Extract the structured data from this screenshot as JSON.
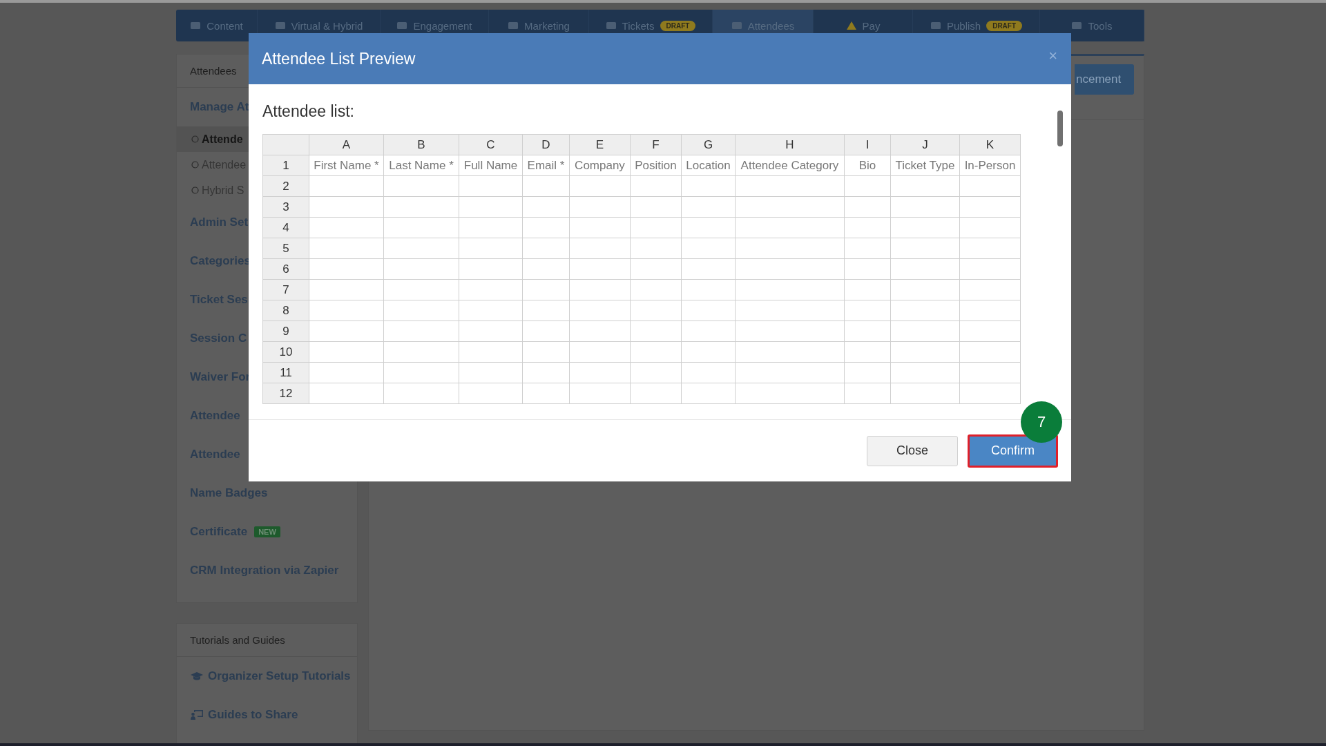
{
  "nav": {
    "tabs": [
      {
        "label": "Content",
        "selected": false
      },
      {
        "label": "Virtual & Hybrid",
        "selected": false
      },
      {
        "label": "Engagement",
        "selected": false
      },
      {
        "label": "Marketing",
        "selected": false
      },
      {
        "label": "Tickets",
        "badge": "DRAFT",
        "selected": false
      },
      {
        "label": "Attendees",
        "selected": true
      },
      {
        "label": "Pay",
        "selected": false
      },
      {
        "label": "Publish",
        "badge": "DRAFT",
        "selected": false
      },
      {
        "label": "Tools",
        "selected": false
      }
    ]
  },
  "sidebar": {
    "header": "Attendees",
    "items": [
      {
        "kind": "section",
        "label": "Manage At"
      },
      {
        "kind": "sub",
        "label": "Attende",
        "selected": true
      },
      {
        "kind": "sub",
        "label": "Attendee",
        "selected": false
      },
      {
        "kind": "sub",
        "label": "Hybrid S",
        "selected": false
      },
      {
        "kind": "section",
        "label": "Admin Set"
      },
      {
        "kind": "section",
        "label": "Categories"
      },
      {
        "kind": "section",
        "label": "Ticket Ses"
      },
      {
        "kind": "section",
        "label": "Session C"
      },
      {
        "kind": "section",
        "label": "Waiver For"
      },
      {
        "kind": "section",
        "label": "Attendee"
      },
      {
        "kind": "section",
        "label": "Attendee"
      },
      {
        "kind": "section",
        "label": "Name Badges"
      },
      {
        "kind": "section",
        "label": "Certificate",
        "badge": "NEW"
      },
      {
        "kind": "section",
        "label": "CRM Integration via Zapier"
      }
    ]
  },
  "guides": {
    "header": "Tutorials and Guides",
    "items": [
      {
        "label": "Organizer Setup Tutorials"
      },
      {
        "label": "Guides to Share"
      }
    ]
  },
  "content": {
    "button": "ncement"
  },
  "modal": {
    "title": "Attendee List Preview",
    "close": "×",
    "list_label": "Attendee list:",
    "table": {
      "columns": [
        "A",
        "B",
        "C",
        "D",
        "E",
        "F",
        "G",
        "H",
        "I",
        "J",
        "K"
      ],
      "rows": [
        {
          "number": "1",
          "cells": [
            "First Name *",
            "Last Name *",
            "Full Name",
            "Email *",
            "Company",
            "Position",
            "Location",
            "Attendee Category",
            "Bio",
            "Ticket Type",
            "In-Person"
          ]
        },
        {
          "number": "2"
        },
        {
          "number": "3"
        },
        {
          "number": "4"
        },
        {
          "number": "5"
        },
        {
          "number": "6"
        },
        {
          "number": "7"
        },
        {
          "number": "8"
        },
        {
          "number": "9"
        },
        {
          "number": "10"
        },
        {
          "number": "11"
        },
        {
          "number": "12"
        }
      ]
    },
    "buttons": [
      {
        "label": "Close",
        "kind": "secondary",
        "highlighted": false
      },
      {
        "label": "Confirm",
        "kind": "primary",
        "highlighted": true
      }
    ],
    "step_badge": "7"
  }
}
